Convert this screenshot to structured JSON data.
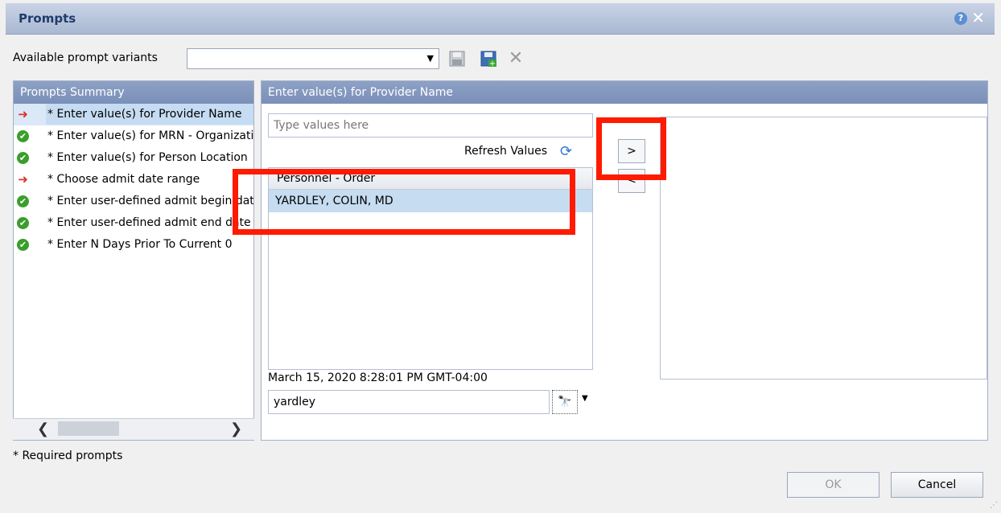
{
  "dialog": {
    "title": "Prompts",
    "help_icon": "?",
    "close_icon": "✕"
  },
  "variants": {
    "label": "Available prompt variants",
    "value": "",
    "icons": [
      "save-icon",
      "save-as-icon",
      "delete-icon"
    ]
  },
  "summary": {
    "header": "Prompts Summary",
    "items": [
      {
        "label": "* Enter value(s) for Provider Name",
        "status": "arrow",
        "selected": true
      },
      {
        "label": "* Enter value(s) for MRN - Organization",
        "status": "check",
        "selected": false
      },
      {
        "label": "* Enter value(s) for Person Location",
        "status": "check",
        "selected": false
      },
      {
        "label": "* Choose admit date range",
        "status": "arrow",
        "selected": false
      },
      {
        "label": "* Enter user-defined admit begin date",
        "status": "check",
        "selected": false
      },
      {
        "label": "* Enter user-defined admit end date",
        "status": "check",
        "selected": false
      },
      {
        "label": "* Enter N Days Prior To Current 0",
        "status": "check",
        "selected": false
      }
    ]
  },
  "entry": {
    "header": "Enter value(s) for Provider Name",
    "type_placeholder": "Type values here",
    "refresh_label": "Refresh Values",
    "list_header": "Personnel - Order",
    "list_items": [
      "YARDLEY, COLIN, MD"
    ],
    "move_right": ">",
    "move_left": "<",
    "timestamp": "March 15, 2020 8:28:01 PM GMT-04:00",
    "search_value": "yardley"
  },
  "footer": {
    "required_note": "* Required prompts",
    "ok_label": "OK",
    "cancel_label": "Cancel"
  },
  "colors": {
    "highlight": "#ff1a00",
    "header": "#7a8fb8",
    "check": "#3a9e2c",
    "arrow": "#e03030"
  }
}
